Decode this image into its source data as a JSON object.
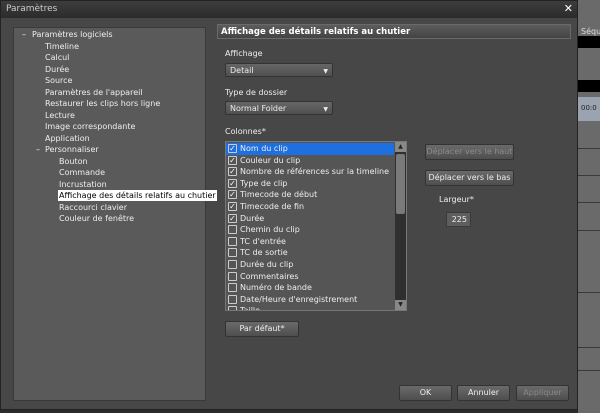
{
  "background_app": {
    "sequence_label": "Séqu",
    "timecode": "00:0"
  },
  "dialog": {
    "title": "Paramètres",
    "close_icon": "close-icon"
  },
  "tree": {
    "root": "Paramètres logiciels",
    "items": [
      "Timeline",
      "Calcul",
      "Durée",
      "Source",
      "Paramètres de l'appareil",
      "Restaurer les clips hors ligne",
      "Lecture",
      "Image correspondante",
      "Application"
    ],
    "group": "Personnaliser",
    "sub_items": [
      "Bouton",
      "Commande",
      "Incrustation",
      "Affichage des détails relatifs au chutier",
      "Raccourci clavier",
      "Couleur de fenêtre"
    ],
    "selected": "Affichage des détails relatifs au chutier"
  },
  "panel": {
    "header": "Affichage des détails relatifs au chutier",
    "display_label": "Affichage",
    "display_value": "Detail",
    "folder_type_label": "Type de dossier",
    "folder_type_value": "Normal Folder",
    "columns_label": "Colonnes*",
    "columns": [
      {
        "label": "Nom du clip",
        "checked": true,
        "selected": true
      },
      {
        "label": "Couleur du clip",
        "checked": true
      },
      {
        "label": "Nombre de références sur la timeline",
        "checked": true
      },
      {
        "label": "Type de clip",
        "checked": true
      },
      {
        "label": "Timecode de début",
        "checked": true
      },
      {
        "label": "Timecode de fin",
        "checked": true
      },
      {
        "label": "Durée",
        "checked": true
      },
      {
        "label": "Chemin du clip",
        "checked": false
      },
      {
        "label": "TC d'entrée",
        "checked": false
      },
      {
        "label": "TC de sortie",
        "checked": false
      },
      {
        "label": "Durée du clip",
        "checked": false
      },
      {
        "label": "Commentaires",
        "checked": false
      },
      {
        "label": "Numéro de bande",
        "checked": false
      },
      {
        "label": "Date/Heure d'enregistrement",
        "checked": false
      },
      {
        "label": "Taille",
        "checked": false
      }
    ],
    "move_up": "Déplacer vers le haut",
    "move_down": "Déplacer vers le bas",
    "width_label": "Largeur*",
    "width_value": "225",
    "default_button": "Par défaut*"
  },
  "footer": {
    "ok": "OK",
    "cancel": "Annuler",
    "apply": "Appliquer"
  }
}
